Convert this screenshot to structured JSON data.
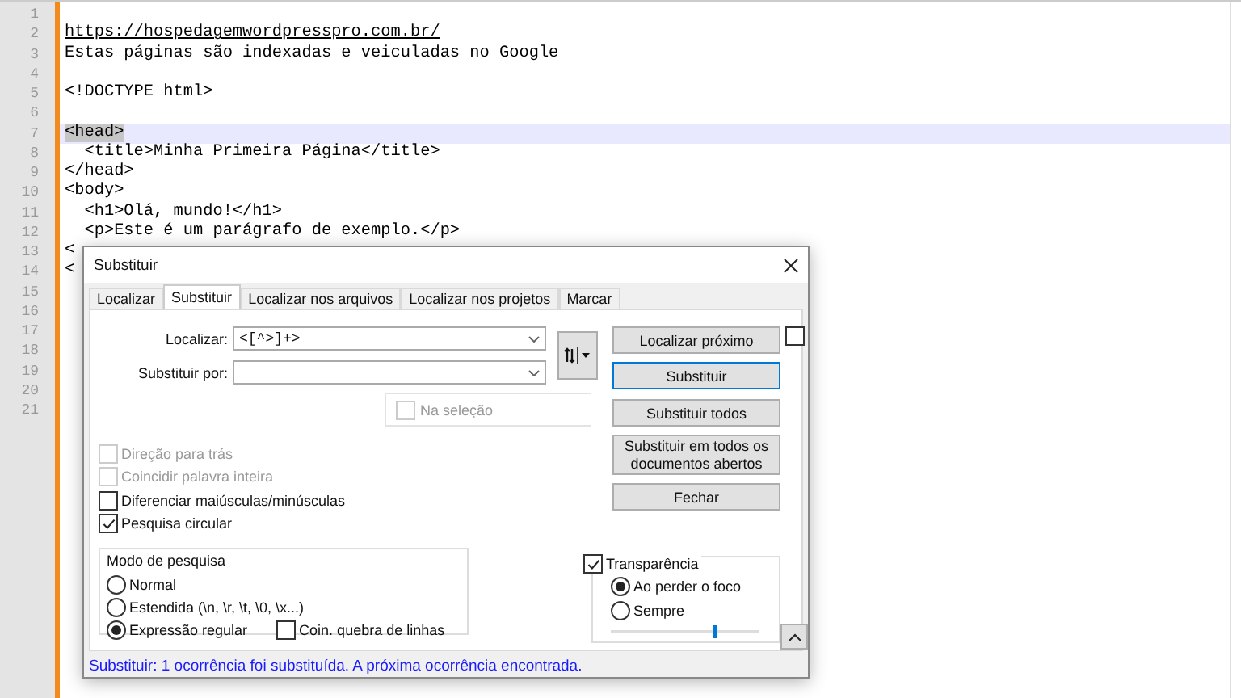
{
  "editor": {
    "lines": [
      {
        "number": "1",
        "current": false,
        "selected": false
      },
      {
        "number": "2",
        "text": "https://hospedagemwordpresspro.com.br/",
        "kind": "link",
        "current": false,
        "selected": false
      },
      {
        "number": "3",
        "text": "Estas páginas são indexadas e veiculadas no Google",
        "kind": "text",
        "current": false,
        "selected": false
      },
      {
        "number": "4",
        "current": false,
        "selected": false
      },
      {
        "number": "5",
        "text": "<!DOCTYPE html>",
        "kind": "text",
        "current": false,
        "selected": false
      },
      {
        "number": "6",
        "current": false,
        "selected": false
      },
      {
        "number": "7",
        "text": "<head>",
        "kind": "text",
        "current": true,
        "selected": true
      },
      {
        "number": "8",
        "text": "  <title>Minha Primeira Página</title>",
        "kind": "text",
        "current": false,
        "selected": false
      },
      {
        "number": "9",
        "text": "</head>",
        "kind": "text",
        "current": false,
        "selected": false
      },
      {
        "number": "10",
        "text": "<body>",
        "kind": "text",
        "current": false,
        "selected": false
      },
      {
        "number": "11",
        "text": "  <h1>Olá, mundo!</h1>",
        "kind": "text",
        "current": false,
        "selected": false
      },
      {
        "number": "12",
        "text": "  <p>Este é um parágrafo de exemplo.</p>",
        "kind": "text",
        "current": false,
        "selected": false
      },
      {
        "number": "13",
        "text": "<",
        "kind": "text",
        "current": false,
        "selected": false
      },
      {
        "number": "14",
        "text": "<",
        "kind": "text",
        "current": false,
        "selected": false
      },
      {
        "number": "15",
        "current": false,
        "selected": false
      },
      {
        "number": "16",
        "current": false,
        "selected": false
      },
      {
        "number": "17",
        "current": false,
        "selected": false
      },
      {
        "number": "18",
        "current": false,
        "selected": false
      },
      {
        "number": "19",
        "current": false,
        "selected": false
      },
      {
        "number": "20",
        "current": false,
        "selected": false
      },
      {
        "number": "21",
        "current": false,
        "selected": false
      }
    ]
  },
  "dialog": {
    "title": "Substituir",
    "tabs": [
      {
        "label": "Localizar",
        "selected": false
      },
      {
        "label": "Substituir",
        "selected": true
      },
      {
        "label": "Localizar nos arquivos",
        "selected": false
      },
      {
        "label": "Localizar nos projetos",
        "selected": false
      },
      {
        "label": "Marcar",
        "selected": false
      }
    ],
    "find": {
      "label": "Localizar:",
      "value": "<[^>]+>"
    },
    "replace": {
      "label": "Substituir por:"
    },
    "in_selection": {
      "label": "Na seleção",
      "checked": false,
      "disabled": true
    },
    "buttons": [
      {
        "label": "Localizar próximo",
        "focused": false
      },
      {
        "label": "Substituir",
        "focused": true
      },
      {
        "label": "Substituir todos",
        "focused": false
      },
      {
        "label": "Substituir em todos os documentos abertos",
        "focused": false
      },
      {
        "label": "Fechar",
        "focused": false
      }
    ],
    "stay_open": {
      "checked": false
    },
    "options": [
      {
        "label": "Direção para trás",
        "checked": false,
        "disabled": true
      },
      {
        "label": "Coincidir palavra inteira",
        "checked": false,
        "disabled": true
      },
      {
        "label": "Diferenciar maiúsculas/minúsculas",
        "checked": false,
        "disabled": false
      },
      {
        "label": "Pesquisa circular",
        "checked": true,
        "disabled": false
      }
    ],
    "search_mode": {
      "title": "Modo de pesquisa",
      "options": [
        {
          "label": "Normal",
          "selected": false
        },
        {
          "label": "Estendida  (\\n, \\r, \\t, \\0, \\x...)",
          "selected": false
        },
        {
          "label": "Expressão regular",
          "selected": true
        }
      ],
      "multiline": {
        "label": "Coin. quebra de linhas",
        "checked": false
      }
    },
    "transparency": {
      "label": "Transparência",
      "checked": true,
      "options": [
        {
          "label": "Ao perder o foco",
          "selected": true
        },
        {
          "label": "Sempre",
          "selected": false
        }
      ],
      "level": 0.7
    },
    "status": "Substituir: 1 ocorrência foi substituída. A próxima ocorrência encontrada."
  }
}
